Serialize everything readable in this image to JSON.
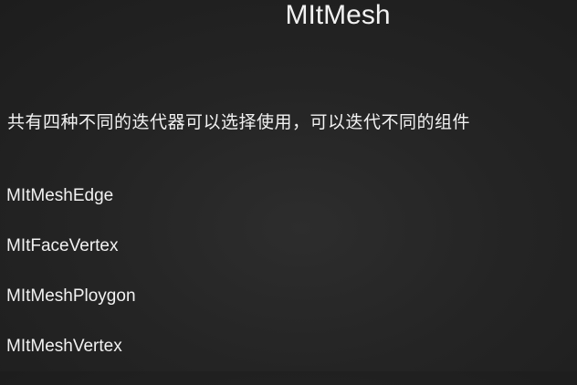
{
  "slide": {
    "title": "MItMesh",
    "intro": "共有四种不同的迭代器可以选择使用，可以迭代不同的组件",
    "iterators": [
      "MItMeshEdge",
      "MItFaceVertex",
      "MItMeshPloygon",
      "MItMeshVertex"
    ]
  },
  "colors": {
    "background": "#1c1c1c",
    "text": "#f2f2f2"
  }
}
